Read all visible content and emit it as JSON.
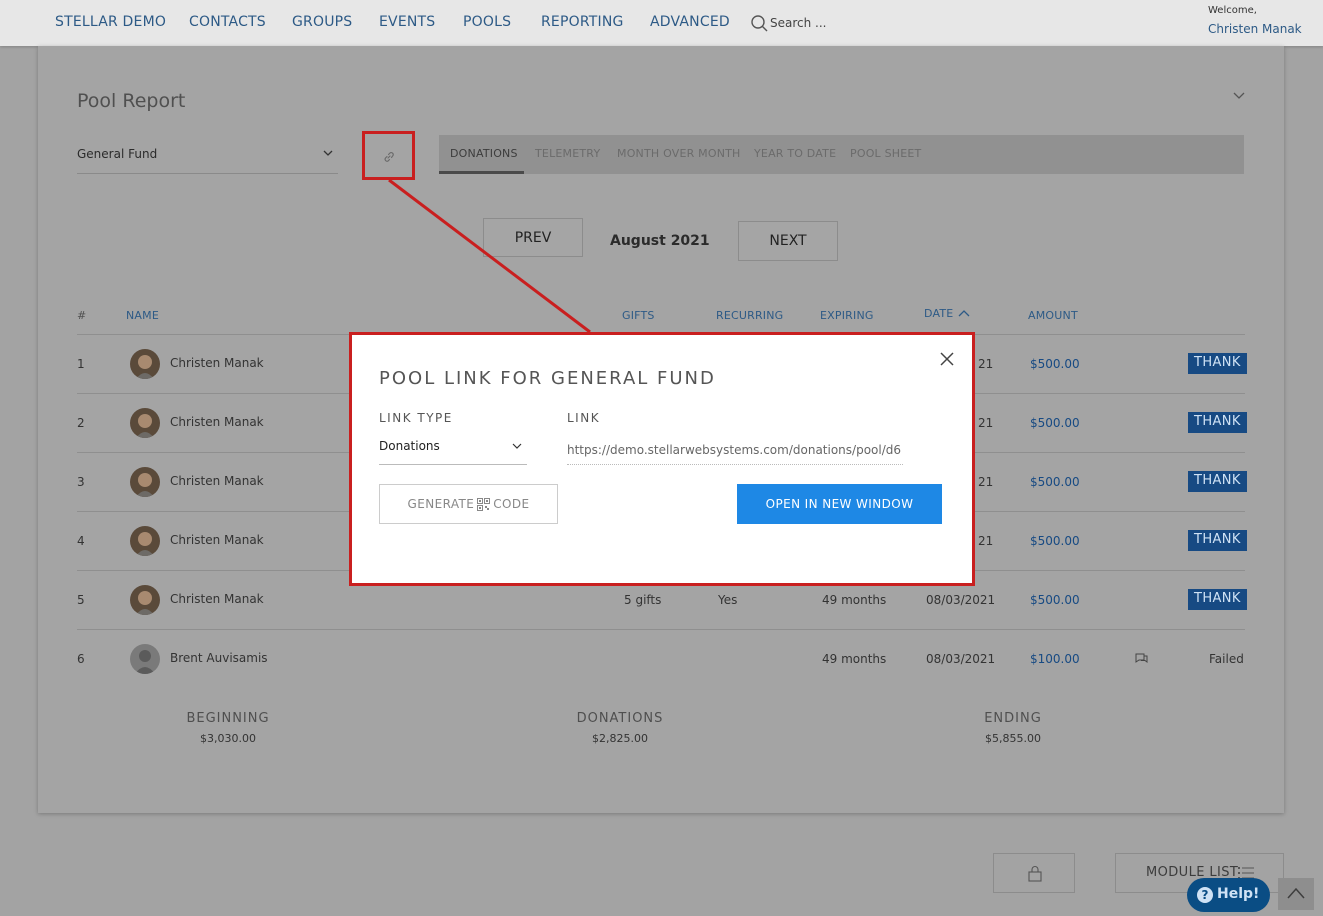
{
  "nav": {
    "items": [
      "STELLAR DEMO",
      "CONTACTS",
      "GROUPS",
      "EVENTS",
      "POOLS",
      "REPORTING",
      "ADVANCED"
    ],
    "search_placeholder": "Search ...",
    "welcome": "Welcome,",
    "user": "Christen Manak"
  },
  "card": {
    "title": "Pool Report",
    "fund": "General Fund",
    "tabs": [
      "DONATIONS",
      "TELEMETRY",
      "MONTH OVER MONTH",
      "YEAR TO DATE",
      "POOL SHEET"
    ],
    "active_tab": "DONATIONS",
    "prev": "PREV",
    "next": "NEXT",
    "month": "August 2021"
  },
  "table": {
    "headers": {
      "num": "#",
      "name": "NAME",
      "gifts": "GIFTS",
      "recurring": "RECURRING",
      "expiring": "EXPIRING",
      "date": "DATE",
      "amount": "AMOUNT"
    },
    "rows": [
      {
        "num": "1",
        "name": "Christen Manak",
        "gifts": "",
        "recurring": "",
        "expiring": "",
        "date": "21",
        "amount": "$500.00",
        "action": "THANK"
      },
      {
        "num": "2",
        "name": "Christen Manak",
        "gifts": "",
        "recurring": "",
        "expiring": "",
        "date": "21",
        "amount": "$500.00",
        "action": "THANK"
      },
      {
        "num": "3",
        "name": "Christen Manak",
        "gifts": "",
        "recurring": "",
        "expiring": "",
        "date": "21",
        "amount": "$500.00",
        "action": "THANK"
      },
      {
        "num": "4",
        "name": "Christen Manak",
        "gifts": "",
        "recurring": "",
        "expiring": "",
        "date": "21",
        "amount": "$500.00",
        "action": "THANK"
      },
      {
        "num": "5",
        "name": "Christen Manak",
        "gifts": "5 gifts",
        "recurring": "Yes",
        "expiring": "49 months",
        "date": "08/03/2021",
        "amount": "$500.00",
        "action": "THANK"
      },
      {
        "num": "6",
        "name": "Brent Auvisamis",
        "gifts": "",
        "recurring": "",
        "expiring": "49 months",
        "date": "08/03/2021",
        "amount": "$100.00",
        "action": "Failed"
      }
    ]
  },
  "summary": {
    "beginning_label": "BEGINNING",
    "beginning_value": "$3,030.00",
    "donations_label": "DONATIONS",
    "donations_value": "$2,825.00",
    "ending_label": "ENDING",
    "ending_value": "$5,855.00"
  },
  "footer": {
    "module_list": "MODULE LIST",
    "help": "Help!",
    "help_q": "?"
  },
  "modal": {
    "title": "POOL LINK FOR GENERAL FUND",
    "link_type_label": "LINK TYPE",
    "link_type_value": "Donations",
    "link_label": "LINK",
    "link_value": "https://demo.stellarwebsystems.com/donations/pool/d6",
    "generate_pre": "GENERATE",
    "generate_post": "CODE",
    "open": "OPEN IN NEW WINDOW"
  },
  "colors": {
    "nav_link": "#2d5a86",
    "accent": "#1e88e5",
    "annotation": "#c91f1f",
    "thank_bg": "#174a83"
  },
  "icons": [
    "search-icon",
    "chevron-down-icon",
    "link-icon",
    "sort-up-icon",
    "comment-icon",
    "lock-icon",
    "list-icon",
    "close-icon",
    "qr-code-icon",
    "arrow-up-icon"
  ]
}
